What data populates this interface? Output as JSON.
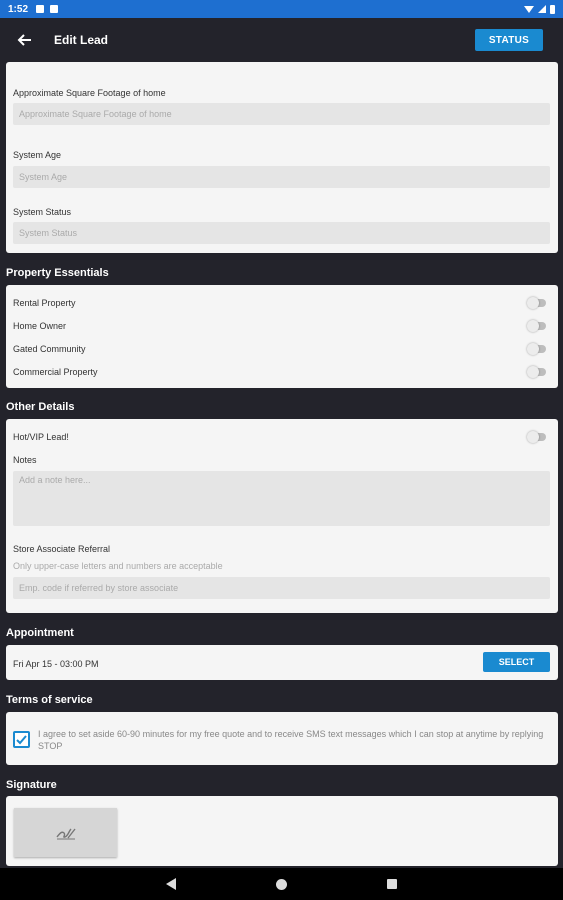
{
  "statusbar": {
    "time": "1:52"
  },
  "appbar": {
    "title": "Edit Lead",
    "status_button": "STATUS"
  },
  "system": {
    "sqft_label": "Approximate Square Footage of home",
    "sqft_placeholder": "Approximate Square Footage of home",
    "age_label": "System Age",
    "age_placeholder": "System Age",
    "status_label": "System Status",
    "status_placeholder": "System Status"
  },
  "property": {
    "title": "Property Essentials",
    "items": [
      {
        "label": "Rental Property",
        "on": false
      },
      {
        "label": "Home Owner",
        "on": false
      },
      {
        "label": "Gated Community",
        "on": false
      },
      {
        "label": "Commercial Property",
        "on": false
      }
    ]
  },
  "other": {
    "title": "Other Details",
    "hot_label": "Hot/VIP Lead!",
    "hot_on": false,
    "notes_label": "Notes",
    "notes_placeholder": "Add a note here...",
    "referral_label": "Store Associate Referral",
    "referral_hint": "Only upper-case letters and numbers are acceptable",
    "referral_placeholder": "Emp. code if referred by store associate"
  },
  "appointment": {
    "title": "Appointment",
    "value": "Fri Apr 15 - 03:00 PM",
    "select_button": "SELECT"
  },
  "terms": {
    "title": "Terms of service",
    "checked": true,
    "text": "I agree to set aside 60-90 minutes for my free quote and to receive SMS text messages which I can stop at anytime by replying STOP"
  },
  "signature": {
    "title": "Signature"
  },
  "colors": {
    "accent": "#1a8ad0",
    "background": "#23232b",
    "card": "#f5f5f5",
    "statusbar": "#1e6fd0"
  }
}
